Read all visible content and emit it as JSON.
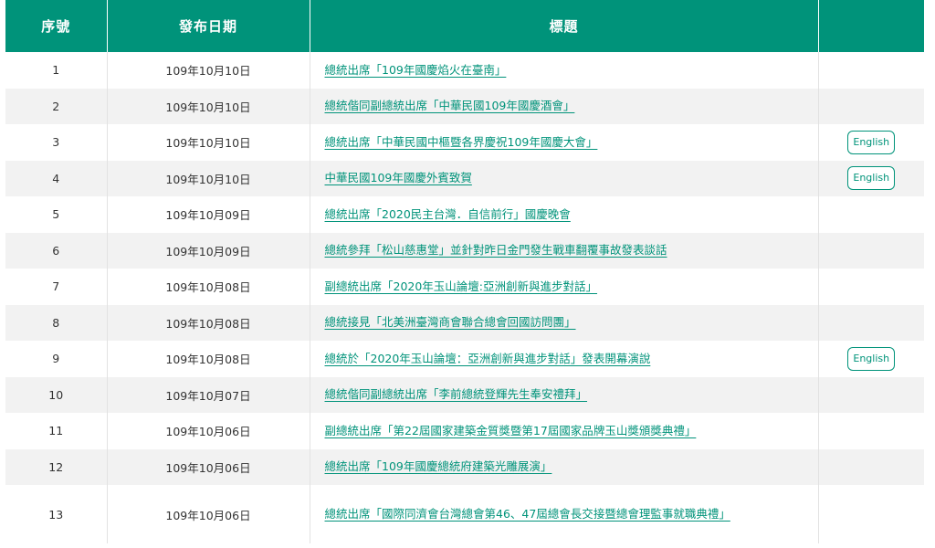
{
  "table": {
    "headers": {
      "no": "序號",
      "date": "發布日期",
      "title": "標題",
      "extra": ""
    },
    "rows": [
      {
        "no": "1",
        "date": "109年10月10日",
        "title": "總統出席「109年國慶焰火在臺南」",
        "english": ""
      },
      {
        "no": "2",
        "date": "109年10月10日",
        "title": "總統偕同副總統出席「中華民國109年國慶酒會」",
        "english": ""
      },
      {
        "no": "3",
        "date": "109年10月10日",
        "title": "總統出席「中華民國中樞暨各界慶祝109年國慶大會」",
        "english": "English"
      },
      {
        "no": "4",
        "date": "109年10月10日",
        "title": "中華民國109年國慶外賓致賀",
        "english": "English"
      },
      {
        "no": "5",
        "date": "109年10月09日",
        "title": "總統出席「2020民主台灣．自信前行」國慶晚會",
        "english": ""
      },
      {
        "no": "6",
        "date": "109年10月09日",
        "title": "總統參拜「松山慈惠堂」並針對昨日金門發生戰車翻覆事故發表談話",
        "english": ""
      },
      {
        "no": "7",
        "date": "109年10月08日",
        "title": "副總統出席「2020年玉山論壇:亞洲創新與進步對話」",
        "english": ""
      },
      {
        "no": "8",
        "date": "109年10月08日",
        "title": "總統接見「北美洲臺灣商會聯合總會回國訪問團」",
        "english": ""
      },
      {
        "no": "9",
        "date": "109年10月08日",
        "title": "總統於「2020年玉山論壇：亞洲創新與進步對話」發表開幕演說",
        "english": "English"
      },
      {
        "no": "10",
        "date": "109年10月07日",
        "title": "總統偕同副總統出席「李前總統登輝先生奉安禮拜」",
        "english": ""
      },
      {
        "no": "11",
        "date": "109年10月06日",
        "title": "副總統出席「第22屆國家建築金質獎暨第17屆國家品牌玉山獎頒獎典禮」",
        "english": ""
      },
      {
        "no": "12",
        "date": "109年10月06日",
        "title": "總統出席「109年國慶總統府建築光雕展演」",
        "english": ""
      },
      {
        "no": "13",
        "date": "109年10月06日",
        "title": "總統出席「國際同濟會台灣總會第46、47屆總會長交接暨總會理監事就職典禮」",
        "english": ""
      }
    ]
  },
  "colors": {
    "header_bg": "#00937a",
    "link": "#00937a",
    "row_alt_bg": "#f2f2f2"
  }
}
